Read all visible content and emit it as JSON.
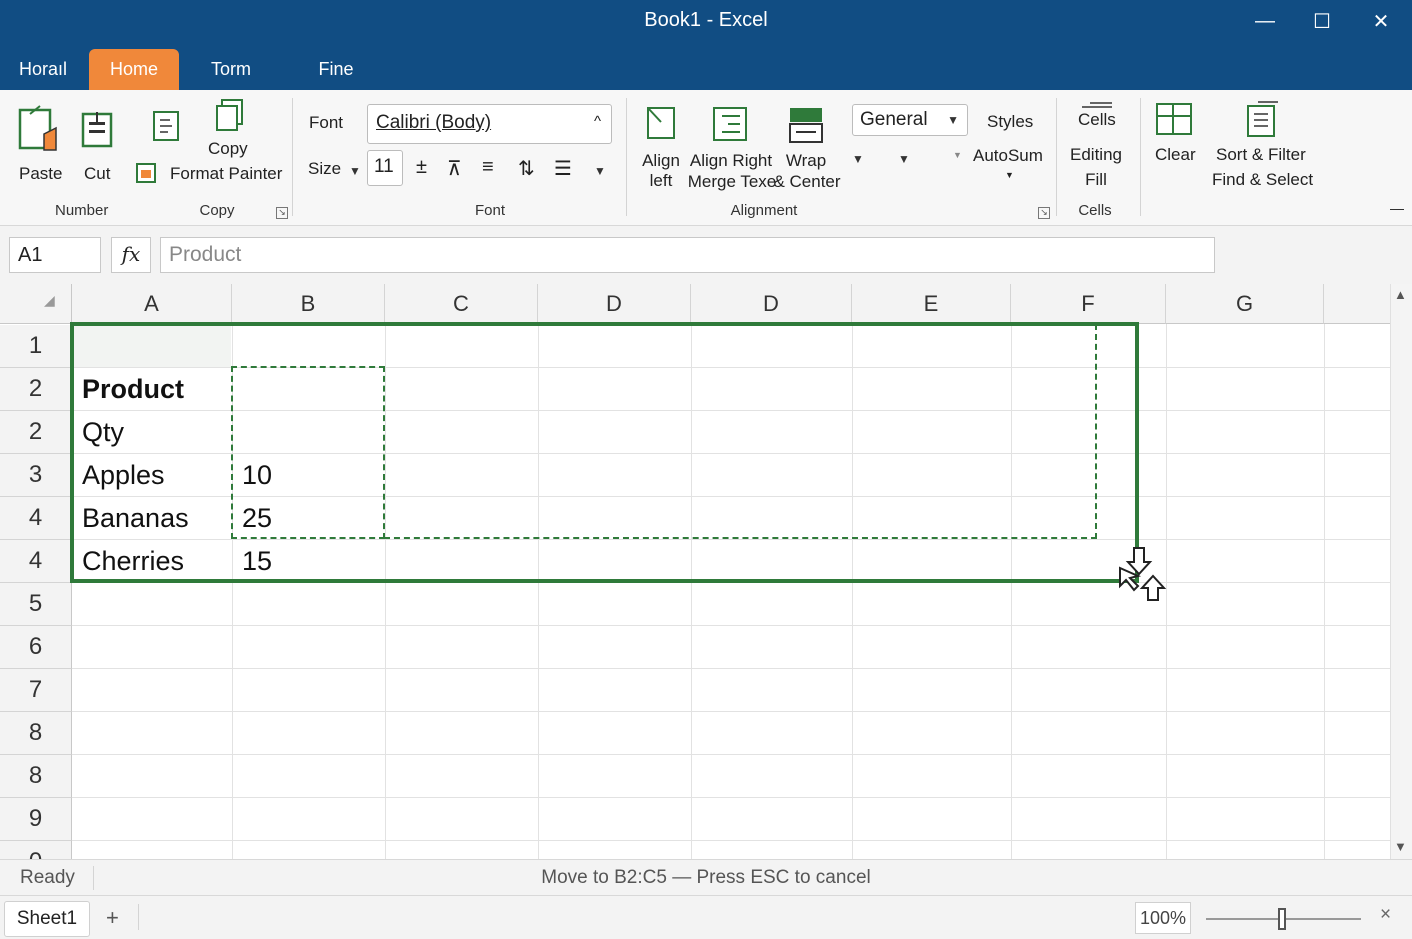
{
  "window": {
    "title": "Book1 - Excel",
    "controls": {
      "minimize": "—",
      "maximize": "☐",
      "close": "✕"
    }
  },
  "tabs": [
    {
      "label": "Horaıl",
      "active": false
    },
    {
      "label": "Home",
      "active": true
    },
    {
      "label": "Torm",
      "active": false
    },
    {
      "label": "Fine",
      "active": false
    }
  ],
  "ribbon": {
    "paste": "Paste",
    "cut": "Cut",
    "copy": "Copy",
    "format_painter": "Format Painter",
    "group_number": "Number",
    "group_copy": "Copy",
    "font_label": "Font",
    "font_value": "Calibri (Body)",
    "size_label": "Size",
    "size_value": "11",
    "group_font": "Font",
    "align_left_1": "Align",
    "align_left_2": "left",
    "align_right": "Align Right",
    "merge": "Merge Texe",
    "wrap": "Wrap",
    "center": "& Center",
    "number_format": "General",
    "styles": "Styles",
    "autosum": "AutoSum",
    "group_alignment": "Alignment",
    "cells": "Cells",
    "editing": "Editing",
    "fill": "Fill",
    "group_cells": "Cells",
    "clear": "Clear",
    "sort_filter": "Sort & Filter",
    "find_select": "Find & Select",
    "collapse": "—"
  },
  "formula_bar": {
    "name_box": "A1",
    "fx": "fx",
    "formula": "Product"
  },
  "grid": {
    "columns": [
      "A",
      "B",
      "C",
      "D",
      "D",
      "E",
      "F",
      "G"
    ],
    "rows": [
      "1",
      "2",
      "2",
      "3",
      "4",
      "4",
      "5",
      "6",
      "7",
      "8",
      "8",
      "9",
      "0"
    ],
    "cells": {
      "a2": "Product",
      "a3": "Qty",
      "a4": "Apples",
      "b4": "10",
      "a5": "Bananas",
      "b5": "25",
      "a6": "Cherries",
      "b6": "15"
    }
  },
  "status": {
    "mode": "Ready",
    "message": "Move to B2:C5 — Press ESC to cancel"
  },
  "sheets": {
    "active": "Sheet1",
    "add": "+"
  },
  "zoom": {
    "level": "100%",
    "close": "×"
  }
}
